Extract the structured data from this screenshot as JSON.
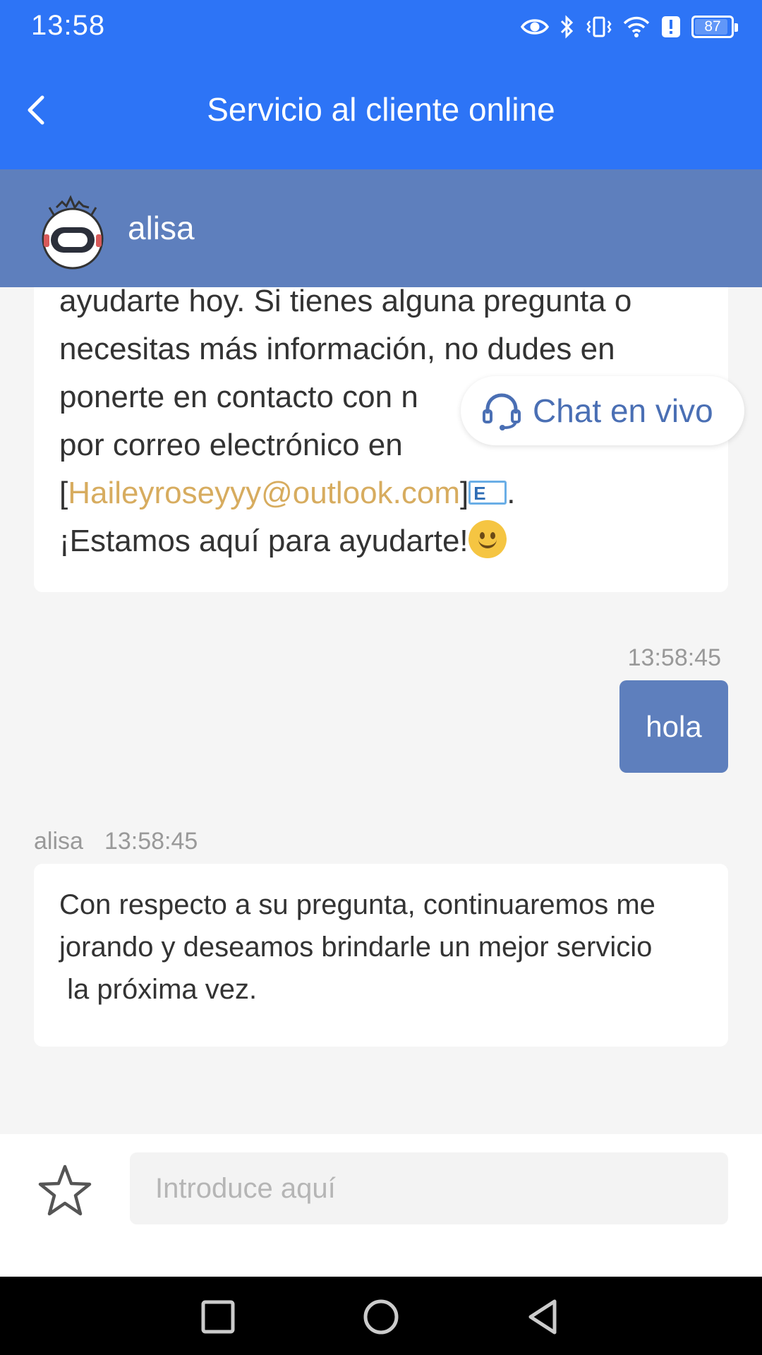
{
  "status_bar": {
    "time": "13:58",
    "battery": "87"
  },
  "header": {
    "title": "Servicio al cliente online",
    "color": "#2d74f6"
  },
  "agent": {
    "name": "alisa",
    "bar_color": "#5e7fbd"
  },
  "live_chat": {
    "label": "Chat en vivo"
  },
  "messages": [
    {
      "from": "agent",
      "lines": [
        "ayudarte hoy. Si tienes alguna pregunta o",
        "necesitas más información, no dudes en",
        "ponerte en contacto con n",
        "por correo electrónico en"
      ],
      "email_open": "[",
      "email": "Haileyroseyyy@outlook.com",
      "email_close": "]",
      "email_after": ".",
      "closing": "¡Estamos aquí para ayudarte!"
    },
    {
      "from": "user",
      "time": "13:58:45",
      "text": "hola"
    },
    {
      "from": "agent",
      "sender": "alisa",
      "time": "13:58:45",
      "text": "Con respecto a su pregunta, continuaremos me\njorando y deseamos brindarle un mejor servicio\n la próxima vez."
    }
  ],
  "input": {
    "placeholder": "Introduce aquí",
    "value": ""
  },
  "icons": {
    "back": "chevron-left-icon",
    "headset": "headset-icon",
    "favorite": "star-outline-icon",
    "mail": "email-emoji-icon",
    "smile": "smile-emoji-icon"
  }
}
